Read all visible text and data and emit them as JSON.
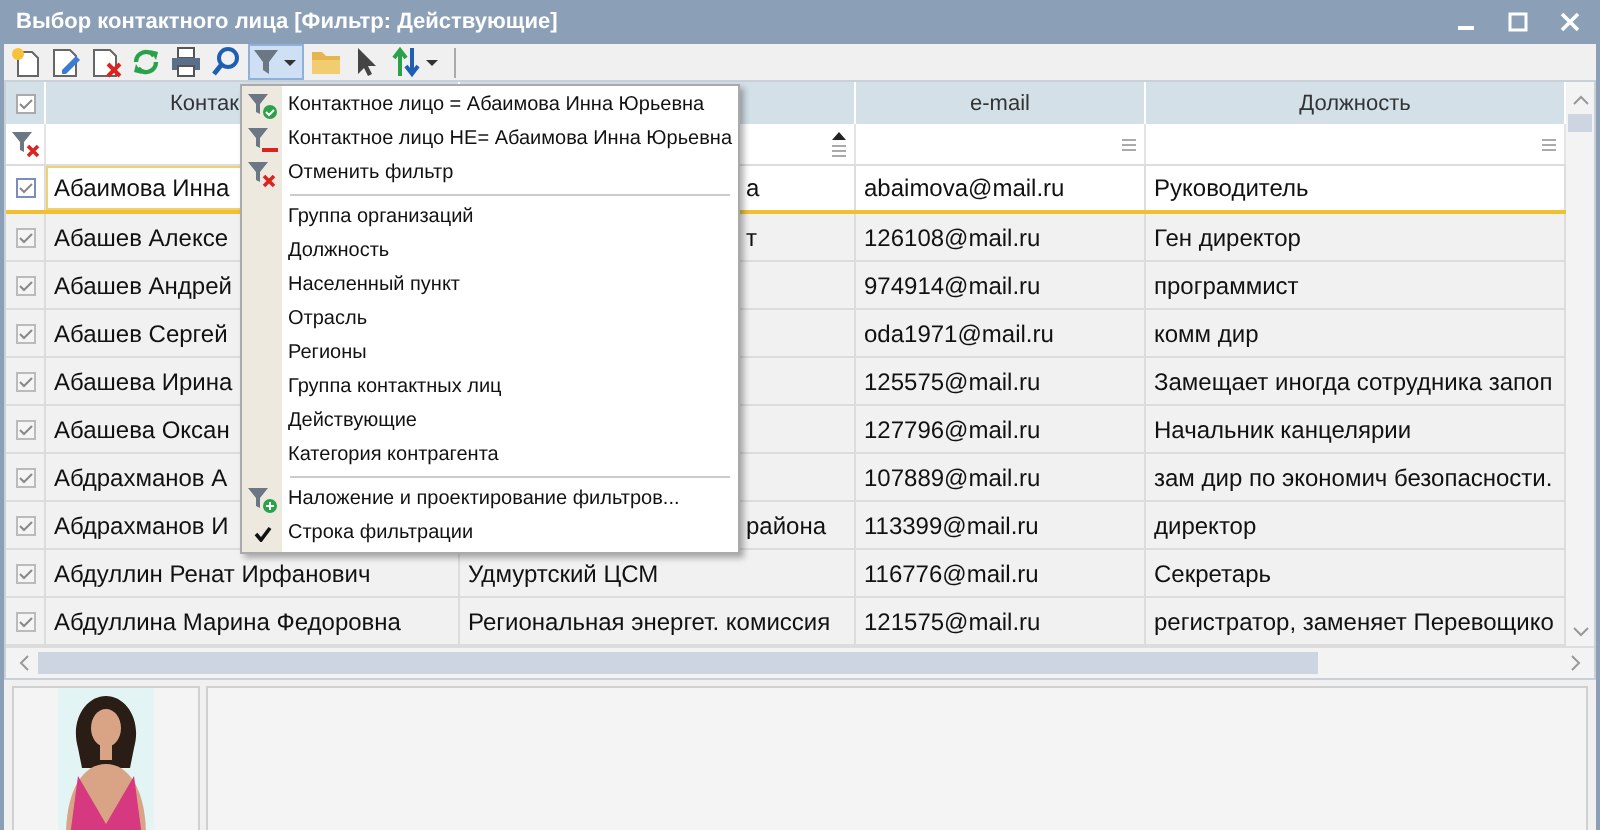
{
  "window": {
    "title": "Выбор контактного лица [Фильтр: Действующие]"
  },
  "toolbar": [
    {
      "kind": "new",
      "pressed": false
    },
    {
      "kind": "edit",
      "pressed": false
    },
    {
      "kind": "delete",
      "pressed": false
    },
    {
      "kind": "refresh",
      "pressed": false
    },
    {
      "kind": "print",
      "pressed": false
    },
    {
      "kind": "search",
      "pressed": false
    },
    {
      "kind": "filter",
      "pressed": true
    },
    {
      "kind": "folder",
      "pressed": false
    },
    {
      "kind": "pointer",
      "pressed": false
    },
    {
      "kind": "sort",
      "pressed": false
    }
  ],
  "table": {
    "columns": [
      "Контак",
      "",
      "e-mail",
      "Должность"
    ],
    "rows": [
      {
        "selected": true,
        "cells": [
          "Абаимова Инна",
          "а",
          "abaimova@mail.ru",
          "Руководитель"
        ]
      },
      {
        "selected": false,
        "cells": [
          "Абашев Алексе",
          "т",
          "126108@mail.ru",
          "Ген директор"
        ]
      },
      {
        "selected": false,
        "cells": [
          "Абашев Андрей",
          "",
          "974914@mail.ru",
          "программист"
        ]
      },
      {
        "selected": false,
        "cells": [
          "Абашев Сергей",
          "",
          "oda1971@mail.ru",
          "комм дир"
        ]
      },
      {
        "selected": false,
        "cells": [
          "Абашева Ирина",
          "",
          "125575@mail.ru",
          "Замещает иногда сотрудника запоп"
        ]
      },
      {
        "selected": false,
        "cells": [
          "Абашева Оксан",
          "",
          "127796@mail.ru",
          "Начальник канцелярии"
        ]
      },
      {
        "selected": false,
        "cells": [
          "Абдрахманов А",
          "",
          "107889@mail.ru",
          "зам дир по экономич безопасности."
        ]
      },
      {
        "selected": false,
        "cells": [
          "Абдрахманов И",
          "района",
          "113399@mail.ru",
          "директор"
        ]
      },
      {
        "selected": false,
        "cells": [
          "Абдуллин Ренат Ирфанович",
          "Удмуртский ЦСМ",
          "116776@mail.ru",
          "Секретарь"
        ]
      },
      {
        "selected": false,
        "cells": [
          "Абдуллина Марина Федоровна",
          "Региональная энергет. комиссия",
          "121575@mail.ru",
          "регистратор, заменяет Перевощико"
        ]
      }
    ]
  },
  "filter_menu": {
    "groups": [
      [
        {
          "kind": "equal",
          "label": "Контактное лицо = Абаимова Инна Юрьевна"
        },
        {
          "kind": "not-equal",
          "label": "Контактное лицо НЕ= Абаимова Инна Юрьевна"
        },
        {
          "kind": "cancel",
          "label": "Отменить фильтр"
        }
      ],
      [
        {
          "kind": "field",
          "label": "Группа организаций"
        },
        {
          "kind": "field",
          "label": "Должность"
        },
        {
          "kind": "field",
          "label": "Населенный пункт"
        },
        {
          "kind": "field",
          "label": "Отрасль"
        },
        {
          "kind": "field",
          "label": "Регионы"
        },
        {
          "kind": "field",
          "label": "Группа контактных лиц"
        },
        {
          "kind": "field",
          "label": "Действующие"
        },
        {
          "kind": "field",
          "label": "Категория контрагента"
        }
      ],
      [
        {
          "kind": "designer",
          "label": "Наложение и проектирование фильтров..."
        },
        {
          "kind": "toggle",
          "label": "Строка фильтрации",
          "checked": true
        }
      ]
    ]
  }
}
